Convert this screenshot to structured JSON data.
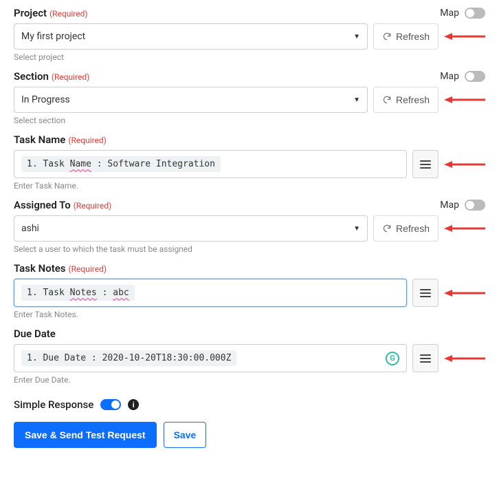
{
  "labels": {
    "required": "(Required)",
    "map": "Map",
    "refresh": "Refresh",
    "simpleResponse": "Simple Response",
    "saveSend": "Save & Send Test Request",
    "save": "Save"
  },
  "fields": {
    "project": {
      "label": "Project",
      "value": "My first project",
      "helper": "Select project"
    },
    "section": {
      "label": "Section",
      "value": "In Progress",
      "helper": "Select section"
    },
    "taskName": {
      "label": "Task Name",
      "chipNum": "1.",
      "chipKey": " Task ",
      "chipWavy": "Name",
      "chipSep": " : ",
      "chipVal": "Software Integration",
      "helper": "Enter Task Name."
    },
    "assignedTo": {
      "label": "Assigned To",
      "value": "ashi",
      "helper": "Select a user to which the task must be assigned"
    },
    "taskNotes": {
      "label": "Task Notes",
      "chipNum": "1.",
      "chipKey": " Task ",
      "chipWavy": "Notes",
      "chipSep": " : ",
      "chipVal": "abc",
      "helper": "Enter Task Notes."
    },
    "dueDate": {
      "label": "Due Date",
      "chipNum": "1.",
      "chipText": " Due Date : 2020-10-20T18:30:00.000Z",
      "helper": "Enter Due Date."
    }
  }
}
